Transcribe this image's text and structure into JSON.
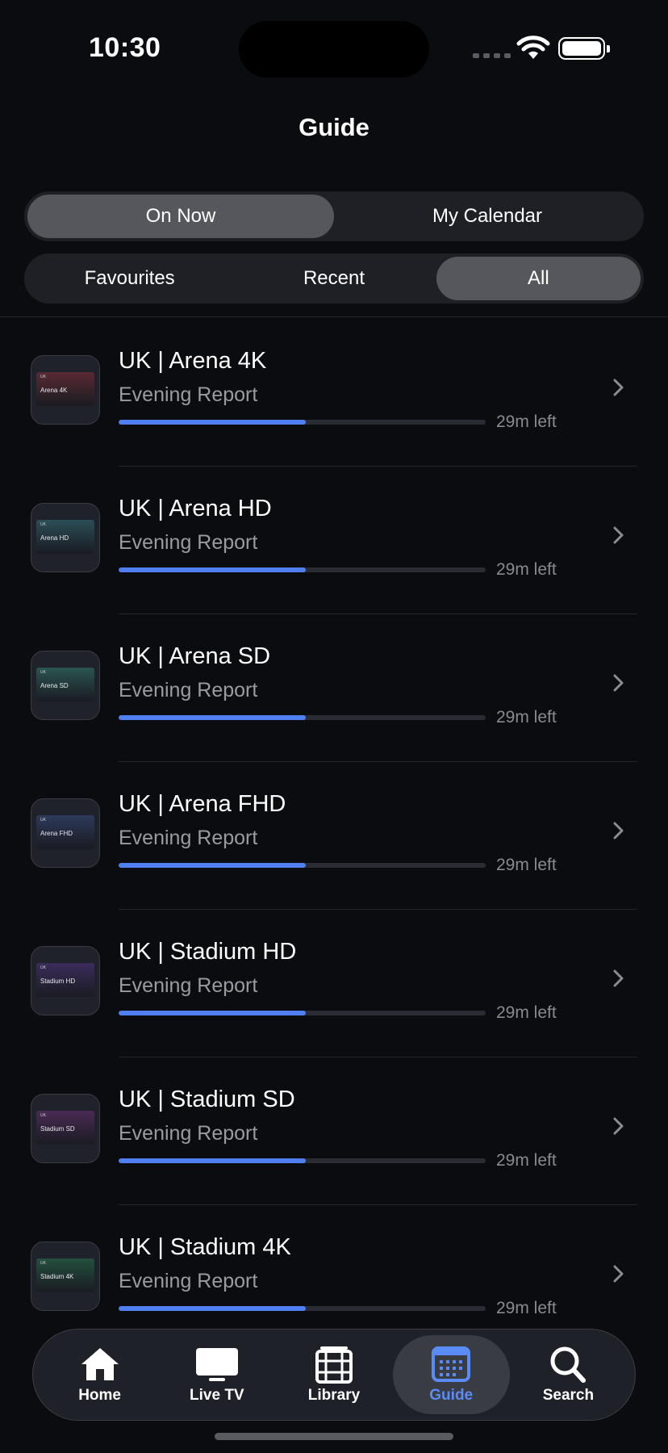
{
  "status_bar": {
    "time": "10:30"
  },
  "header": {
    "title": "Guide"
  },
  "segment_top": {
    "options": [
      "On Now",
      "My Calendar"
    ],
    "selected": "On Now"
  },
  "segment_bottom": {
    "options": [
      "Favourites",
      "Recent",
      "All"
    ],
    "selected": "All"
  },
  "channels": [
    {
      "name": "UK | Arena 4K",
      "thumb_label": "Arena 4K",
      "thumb_tag": "UK",
      "program": "Evening Report",
      "remaining": "29m left",
      "progress": 0.51,
      "tile_color": "#5a2a33"
    },
    {
      "name": "UK | Arena HD",
      "thumb_label": "Arena HD",
      "thumb_tag": "UK",
      "program": "Evening Report",
      "remaining": "29m left",
      "progress": 0.51,
      "tile_color": "#2b4e57"
    },
    {
      "name": "UK | Arena SD",
      "thumb_label": "Arena SD",
      "thumb_tag": "UK",
      "program": "Evening Report",
      "remaining": "29m left",
      "progress": 0.51,
      "tile_color": "#2a5550"
    },
    {
      "name": "UK | Arena FHD",
      "thumb_label": "Arena FHD",
      "thumb_tag": "UK",
      "program": "Evening Report",
      "remaining": "29m left",
      "progress": 0.51,
      "tile_color": "#2d3a5c"
    },
    {
      "name": "UK | Stadium HD",
      "thumb_label": "Stadium HD",
      "thumb_tag": "UK",
      "program": "Evening Report",
      "remaining": "29m left",
      "progress": 0.51,
      "tile_color": "#3a2c5c"
    },
    {
      "name": "UK | Stadium SD",
      "thumb_label": "Stadium SD",
      "thumb_tag": "UK",
      "program": "Evening Report",
      "remaining": "29m left",
      "progress": 0.51,
      "tile_color": "#4a2a55"
    },
    {
      "name": "UK | Stadium 4K",
      "thumb_label": "Stadium 4K",
      "thumb_tag": "UK",
      "program": "Evening Report",
      "remaining": "29m left",
      "progress": 0.51,
      "tile_color": "#24503e"
    }
  ],
  "tab_bar": {
    "tabs": [
      {
        "label": "Home",
        "icon": "house-icon"
      },
      {
        "label": "Live TV",
        "icon": "tv-icon"
      },
      {
        "label": "Library",
        "icon": "film-icon"
      },
      {
        "label": "Guide",
        "icon": "calendar-icon"
      },
      {
        "label": "Search",
        "icon": "magnifier-icon"
      }
    ],
    "selected": "Guide",
    "accent_color": "#5b8cf5"
  }
}
